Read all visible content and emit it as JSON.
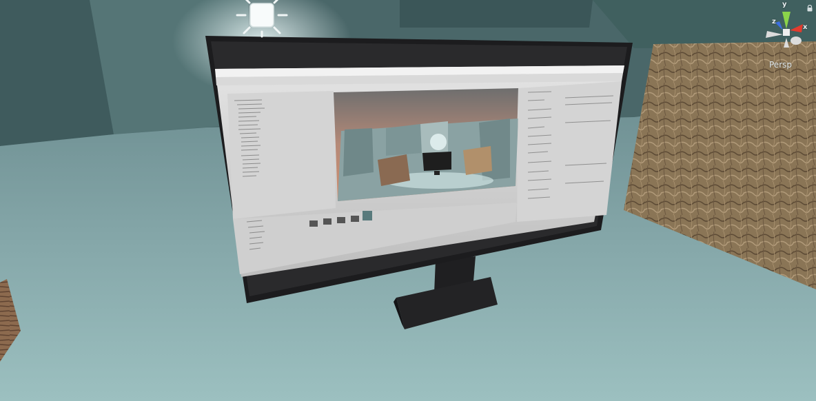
{
  "scene_view": {
    "camera_mode": "Persp",
    "gizmo": {
      "y_label": "y",
      "z_label": "z",
      "x_label": "x"
    },
    "colors": {
      "sky_room": "#4c6a6c",
      "floor": "#8fb0b3",
      "monitor_bezel": "#1c1c1e",
      "texture_panel": "#8a7556",
      "axis_x": "#e23b2e",
      "axis_y": "#8bd34a",
      "axis_z": "#3b6fe0"
    },
    "icons": [
      "directional-light-icon",
      "lock-icon",
      "orientation-gizmo-icon"
    ]
  }
}
